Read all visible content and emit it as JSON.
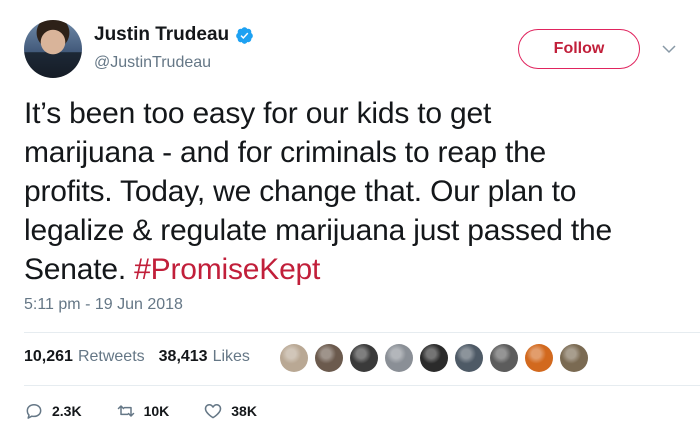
{
  "author": {
    "name": "Justin Trudeau",
    "handle": "@JustinTrudeau",
    "verified_icon": "verified-badge-icon"
  },
  "follow_button": {
    "label": "Follow"
  },
  "tweet": {
    "lines": [
      "It’s been too easy for our kids to get",
      "marijuana - and for criminals to reap the",
      "profits. Today, we change that. Our plan to",
      "legalize & regulate marijuana just passed the",
      "Senate. "
    ],
    "hashtag": "#PromiseKept",
    "timestamp": "5:11 pm - 19 Jun 2018"
  },
  "stats": {
    "retweets_count": "10,261",
    "retweets_label": "Retweets",
    "likes_count": "38,413",
    "likes_label": "Likes"
  },
  "liker_faces": [
    "#b9a894",
    "#6b5a4d",
    "#3a3a3a",
    "#8a8f96",
    "#2b2b2b",
    "#4e5a66",
    "#5c5c5c",
    "#d2691e",
    "#7a6a52"
  ],
  "actions": {
    "reply_count": "2.3K",
    "retweet_count": "10K",
    "like_count": "38K"
  },
  "colors": {
    "accent": "#e0245e",
    "hashtag": "#c11f3a",
    "secondary_text": "#657786",
    "verified": "#1da1f2"
  }
}
